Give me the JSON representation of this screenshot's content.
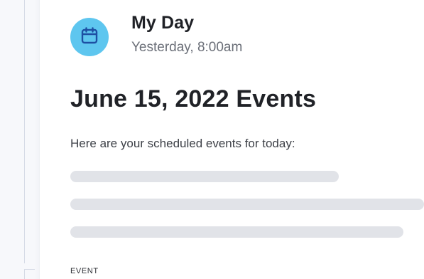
{
  "notification": {
    "app_name": "My Day",
    "timestamp": "Yesterday, 8:00am",
    "icon": "calendar-icon",
    "icon_bg_color": "#5ec6ef"
  },
  "message": {
    "title": "June 15, 2022 Events",
    "intro": "Here are your scheduled events for today:",
    "section_label": "EVENT"
  }
}
